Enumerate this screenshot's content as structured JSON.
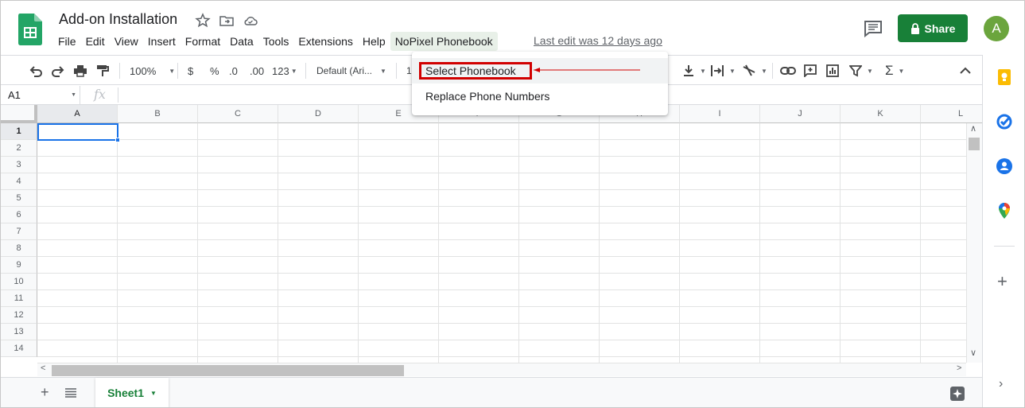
{
  "header": {
    "title": "Add-on Installation",
    "last_edit": "Last edit was 12 days ago",
    "share_label": "Share",
    "avatar_initial": "A"
  },
  "menubar": [
    "File",
    "Edit",
    "View",
    "Insert",
    "Format",
    "Data",
    "Tools",
    "Extensions",
    "Help",
    "NoPixel Phonebook"
  ],
  "toolbar": {
    "zoom": "100%",
    "currency": "$",
    "percent": "%",
    "dec_decrease": ".0",
    "dec_increase": ".00",
    "more_formats": "123",
    "font": "Default (Ari...",
    "font_size_partial": "1"
  },
  "formula_bar": {
    "cell_ref": "A1",
    "fx": "fx"
  },
  "columns": [
    "A",
    "B",
    "C",
    "D",
    "E",
    "F",
    "G",
    "H",
    "I",
    "J",
    "K",
    "L"
  ],
  "rows": [
    "1",
    "2",
    "3",
    "4",
    "5",
    "6",
    "7",
    "8",
    "9",
    "10",
    "11",
    "12",
    "13",
    "14"
  ],
  "dropdown": {
    "items": [
      "Select Phonebook",
      "Replace Phone Numbers"
    ]
  },
  "sheets": {
    "active": "Sheet1"
  },
  "colors": {
    "accent": "#188038",
    "selection": "#1a73e8",
    "annotation": "#d10000"
  }
}
